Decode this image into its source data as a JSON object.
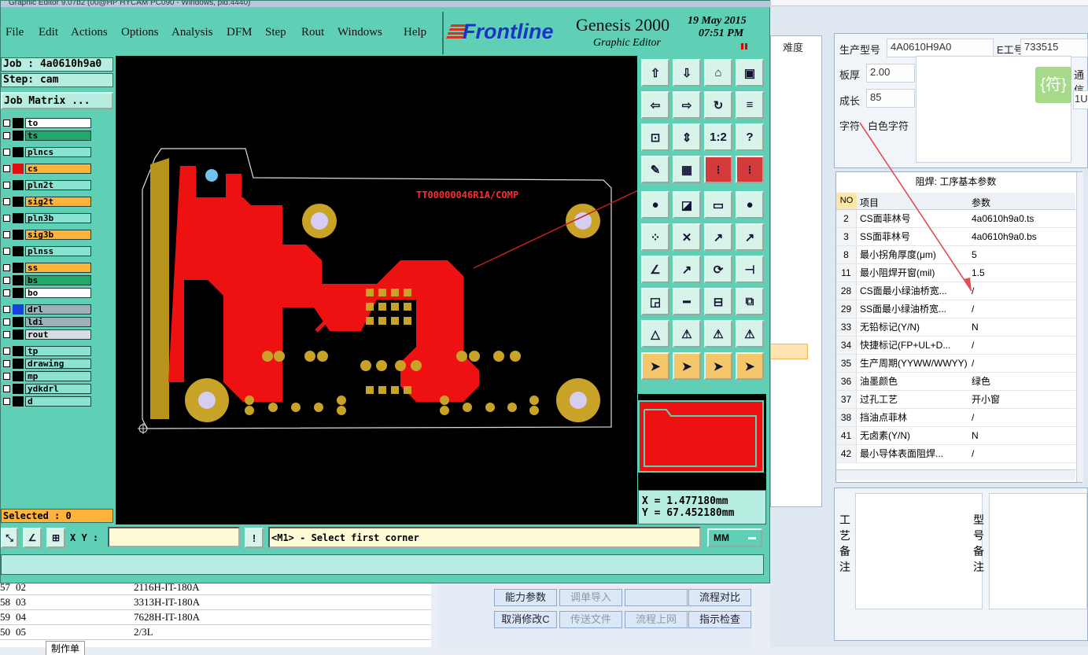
{
  "window": {
    "title": "Graphic Editor 9.07b2 (00@HP HYCAM PC090 - Windows, pid:4440)"
  },
  "menu": [
    "File",
    "Edit",
    "Actions",
    "Options",
    "Analysis",
    "DFM",
    "Step",
    "Rout",
    "Windows",
    "Help"
  ],
  "logo": {
    "brand": "Frontline",
    "product": "Genesis 2000",
    "subtitle": "Graphic Editor",
    "date": "19 May 2015",
    "time": "07:51 PM"
  },
  "job": {
    "name": "Job : 4a0610h9a0",
    "step": "Step: cam",
    "matrix_button": "Job Matrix ..."
  },
  "layers": [
    {
      "name": "to",
      "color": "#ffffff",
      "swatch": "#000000"
    },
    {
      "name": "ts",
      "color": "#22a86b",
      "swatch": "#000000"
    },
    {
      "name": "plncs",
      "color": "#88e4d0",
      "swatch": "#000000"
    },
    {
      "name": "cs",
      "color": "#ffb33a",
      "swatch": "#e01010"
    },
    {
      "name": "pln2t",
      "color": "#88e4d0",
      "swatch": "#000000"
    },
    {
      "name": "sig2t",
      "color": "#ffb33a",
      "swatch": "#000000"
    },
    {
      "name": "pln3b",
      "color": "#88e4d0",
      "swatch": "#000000"
    },
    {
      "name": "sig3b",
      "color": "#ffb33a",
      "swatch": "#000000"
    },
    {
      "name": "plnss",
      "color": "#88e4d0",
      "swatch": "#000000"
    },
    {
      "name": "ss",
      "color": "#ffb33a",
      "swatch": "#000000"
    },
    {
      "name": "bs",
      "color": "#22a86b",
      "swatch": "#000000"
    },
    {
      "name": "bo",
      "color": "#ffffff",
      "swatch": "#000000"
    },
    {
      "name": "drl",
      "color": "#9fb0b8",
      "swatch": "#1a3fe0"
    },
    {
      "name": "ldi",
      "color": "#9fb0b8",
      "swatch": "#000000"
    },
    {
      "name": "rout",
      "color": "#d7dde0",
      "swatch": "#000000"
    },
    {
      "name": "tp",
      "color": "#88e4d0",
      "swatch": "#000000"
    },
    {
      "name": "drawing",
      "color": "#88e4d0",
      "swatch": "#000000"
    },
    {
      "name": "mp",
      "color": "#88e4d0",
      "swatch": "#000000"
    },
    {
      "name": "ydkdrl",
      "color": "#88e4d0",
      "swatch": "#000000"
    },
    {
      "name": "d",
      "color": "#88e4d0",
      "swatch": "#000000"
    }
  ],
  "selected": "Selected : 0",
  "board_label": "TT00000046R1A/COMP",
  "coords": {
    "x": "X =  1.477180mm",
    "y": "Y = 67.452180mm"
  },
  "xy_label": "X Y :",
  "prompt": "<M1> - Select first corner",
  "units": "MM",
  "right": {
    "model_label": "生产型号",
    "model_value": "4A0610H9A0",
    "e_label": "E工号",
    "e_value": "733515",
    "thick_label": "板厚",
    "thick_value": "2.00",
    "len_label": "成长",
    "len_value": "85",
    "char_label": "字符",
    "char_value": "白色字符",
    "badge": "{符}",
    "cut1": "通信",
    "cut2": "1U",
    "difficulty": "难度"
  },
  "table": {
    "title": "阻焊: 工序基本参数",
    "headers": [
      "NO",
      "项目",
      "参数"
    ],
    "rows": [
      {
        "no": "2",
        "item": "CS面菲林号",
        "param": "4a0610h9a0.ts"
      },
      {
        "no": "3",
        "item": "SS面菲林号",
        "param": "4a0610h9a0.bs"
      },
      {
        "no": "8",
        "item": "最小拐角厚度(μm)",
        "param": "5"
      },
      {
        "no": "11",
        "item": "最小阻焊开窗(mil)",
        "param": "1.5"
      },
      {
        "no": "28",
        "item": "CS面最小绿油桥宽...",
        "param": "/"
      },
      {
        "no": "29",
        "item": "SS面最小绿油桥宽...",
        "param": "/"
      },
      {
        "no": "33",
        "item": "无铅标记(Y/N)",
        "param": "N"
      },
      {
        "no": "34",
        "item": "快捷标记(FP+UL+D...",
        "param": "/"
      },
      {
        "no": "35",
        "item": "生产周期(YYWW/WWYY)",
        "param": "/"
      },
      {
        "no": "36",
        "item": "油墨颜色",
        "param": "绿色"
      },
      {
        "no": "37",
        "item": "过孔工艺",
        "param": "开小窗"
      },
      {
        "no": "38",
        "item": "挡油点菲林",
        "param": "/"
      },
      {
        "no": "41",
        "item": "无卤素(Y/N)",
        "param": "N"
      },
      {
        "no": "42",
        "item": "最小导体表面阻焊...",
        "param": "/"
      }
    ]
  },
  "notes": {
    "process": "工艺备注",
    "model": "型号备注"
  },
  "buttons": [
    "能力参数",
    "调单导入",
    "",
    "流程对比",
    "取消修改C",
    "传送文件",
    "流程上网",
    "指示检查"
  ],
  "grid_rows": [
    {
      "a": "57",
      "b": "02",
      "c": "2116H-IT-180A"
    },
    {
      "a": "58",
      "b": "03",
      "c": "3313H-IT-180A"
    },
    {
      "a": "59",
      "b": "04",
      "c": "7628H-IT-180A"
    },
    {
      "a": "50",
      "b": "05",
      "c": "2/3L"
    }
  ],
  "grid_tab": "制作单"
}
